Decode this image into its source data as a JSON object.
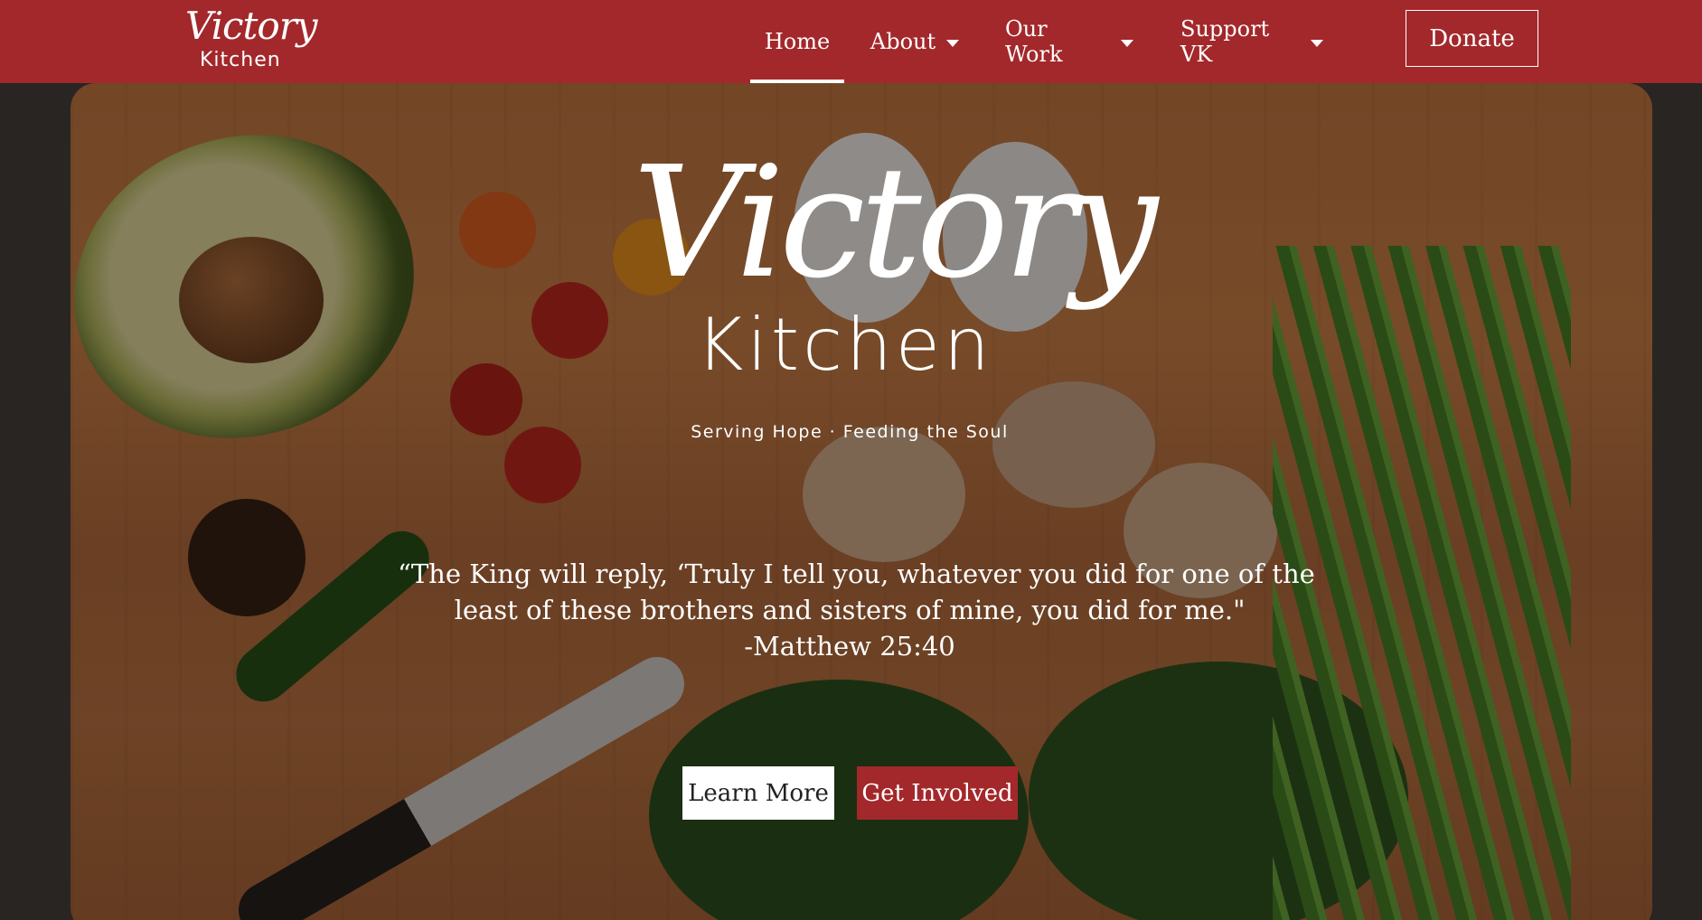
{
  "header": {
    "logo": {
      "line1": "Victory",
      "line2": "Kitchen"
    },
    "nav": [
      {
        "label": "Home",
        "active": true
      },
      {
        "label": "About",
        "dropdown": true
      },
      {
        "label": "Our Work",
        "dropdown": true
      },
      {
        "label": "Support VK",
        "dropdown": true
      }
    ],
    "donate_label": "Donate"
  },
  "hero": {
    "logo": {
      "line1": "Victory",
      "line2": "Kitchen"
    },
    "tagline": "Serving Hope · Feeding the Soul",
    "quote": {
      "line1": "“The King will reply, ‘Truly I tell you, whatever you did for one of the",
      "line2": "least of these brothers and sisters of mine, you did for me.\"",
      "attribution": "-Matthew 25:40"
    },
    "buttons": {
      "learn_more": "Learn More",
      "get_involved": "Get Involved"
    }
  },
  "colors": {
    "brand_red": "#a3282b",
    "white": "#ffffff"
  }
}
